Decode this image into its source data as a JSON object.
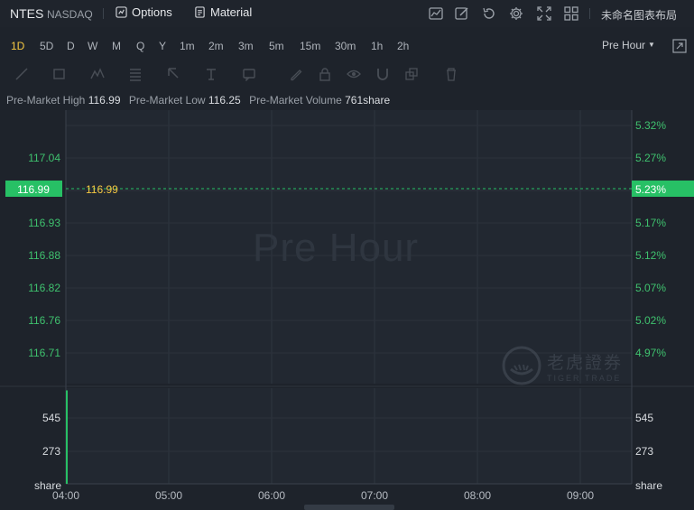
{
  "header": {
    "ticker": "NTES",
    "exchange": "NASDAQ",
    "options_label": "Options",
    "material_label": "Material",
    "layout_name": "未命名图表布局"
  },
  "toolbar_icons": [
    "chart-type-icon",
    "draw-icon",
    "undo-icon",
    "settings-icon",
    "fullscreen-icon",
    "grid-layout-icon"
  ],
  "periods": [
    "1D",
    "5D",
    "D",
    "W",
    "M",
    "Q",
    "Y",
    "1m",
    "2m",
    "3m",
    "5m",
    "15m",
    "30m",
    "1h",
    "2h"
  ],
  "active_period": "1D",
  "session_select": "Pre Hour",
  "draw_tools": [
    "line-tool-icon",
    "rect-tool-icon",
    "pattern-tool-icon",
    "fib-tool-icon",
    "cursor-tool-icon",
    "text-tool-icon",
    "comment-tool-icon",
    "pen-icon",
    "lock-icon",
    "eye-icon",
    "magnet-icon",
    "layers-icon",
    "trash-icon"
  ],
  "info": {
    "high_label": "Pre-Market High",
    "high_value": "116.99",
    "low_label": "Pre-Market Low",
    "low_value": "116.25",
    "volume_label": "Pre-Market Volume",
    "volume_value": "761share"
  },
  "watermark": "Pre Hour",
  "brand": {
    "cn": "老虎證券",
    "en": "TIGER TRADE"
  },
  "chart_data": {
    "type": "line",
    "session": "Pre Hour",
    "x_ticks": [
      "04:00",
      "05:00",
      "06:00",
      "07:00",
      "08:00",
      "09:00"
    ],
    "price_ticks": [
      "117.04",
      "116.93",
      "116.88",
      "116.82",
      "116.76",
      "116.71"
    ],
    "pct_ticks": [
      "5.32%",
      "5.27%",
      "5.17%",
      "5.12%",
      "5.07%",
      "5.02%",
      "4.97%"
    ],
    "current_price": "116.99",
    "current_pct": "5.23%",
    "price_line_label": "116.99",
    "volume_ticks": [
      "545",
      "273"
    ],
    "volume_unit": "share",
    "volume_bars": [
      {
        "x": "04:00",
        "volume": 761
      }
    ],
    "colors": {
      "up": "#27c065",
      "price_line": "#f5c842",
      "axis_text": "#3fc16e"
    }
  }
}
